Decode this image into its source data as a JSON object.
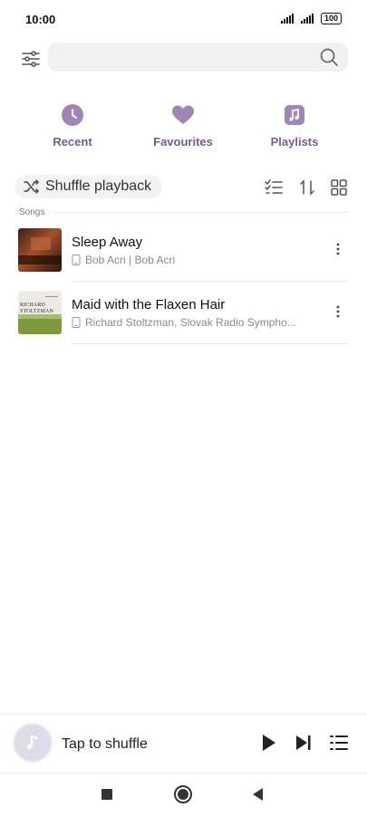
{
  "status_bar": {
    "time": "10:00",
    "battery": "100"
  },
  "search": {
    "value": "",
    "placeholder": ""
  },
  "quick_links": [
    {
      "label": "Recent",
      "icon": "clock-icon"
    },
    {
      "label": "Favourites",
      "icon": "heart-icon"
    },
    {
      "label": "Playlists",
      "icon": "music-note-icon"
    }
  ],
  "toolbar": {
    "shuffle_label": "Shuffle playback"
  },
  "section": {
    "label": "Songs"
  },
  "songs": [
    {
      "title": "Sleep Away",
      "subtitle": "Bob Acri | Bob Acri"
    },
    {
      "title": "Maid with the Flaxen Hair",
      "subtitle": "Richard Stoltzman, Slovak Radio Sympho..."
    }
  ],
  "album_art_text": {
    "line1": "RICHARD",
    "line2": "STOLTZMAN"
  },
  "player": {
    "text": "Tap to shuffle"
  },
  "colors": {
    "accent": "#a086b6",
    "accent_text": "#7a5b8c"
  }
}
